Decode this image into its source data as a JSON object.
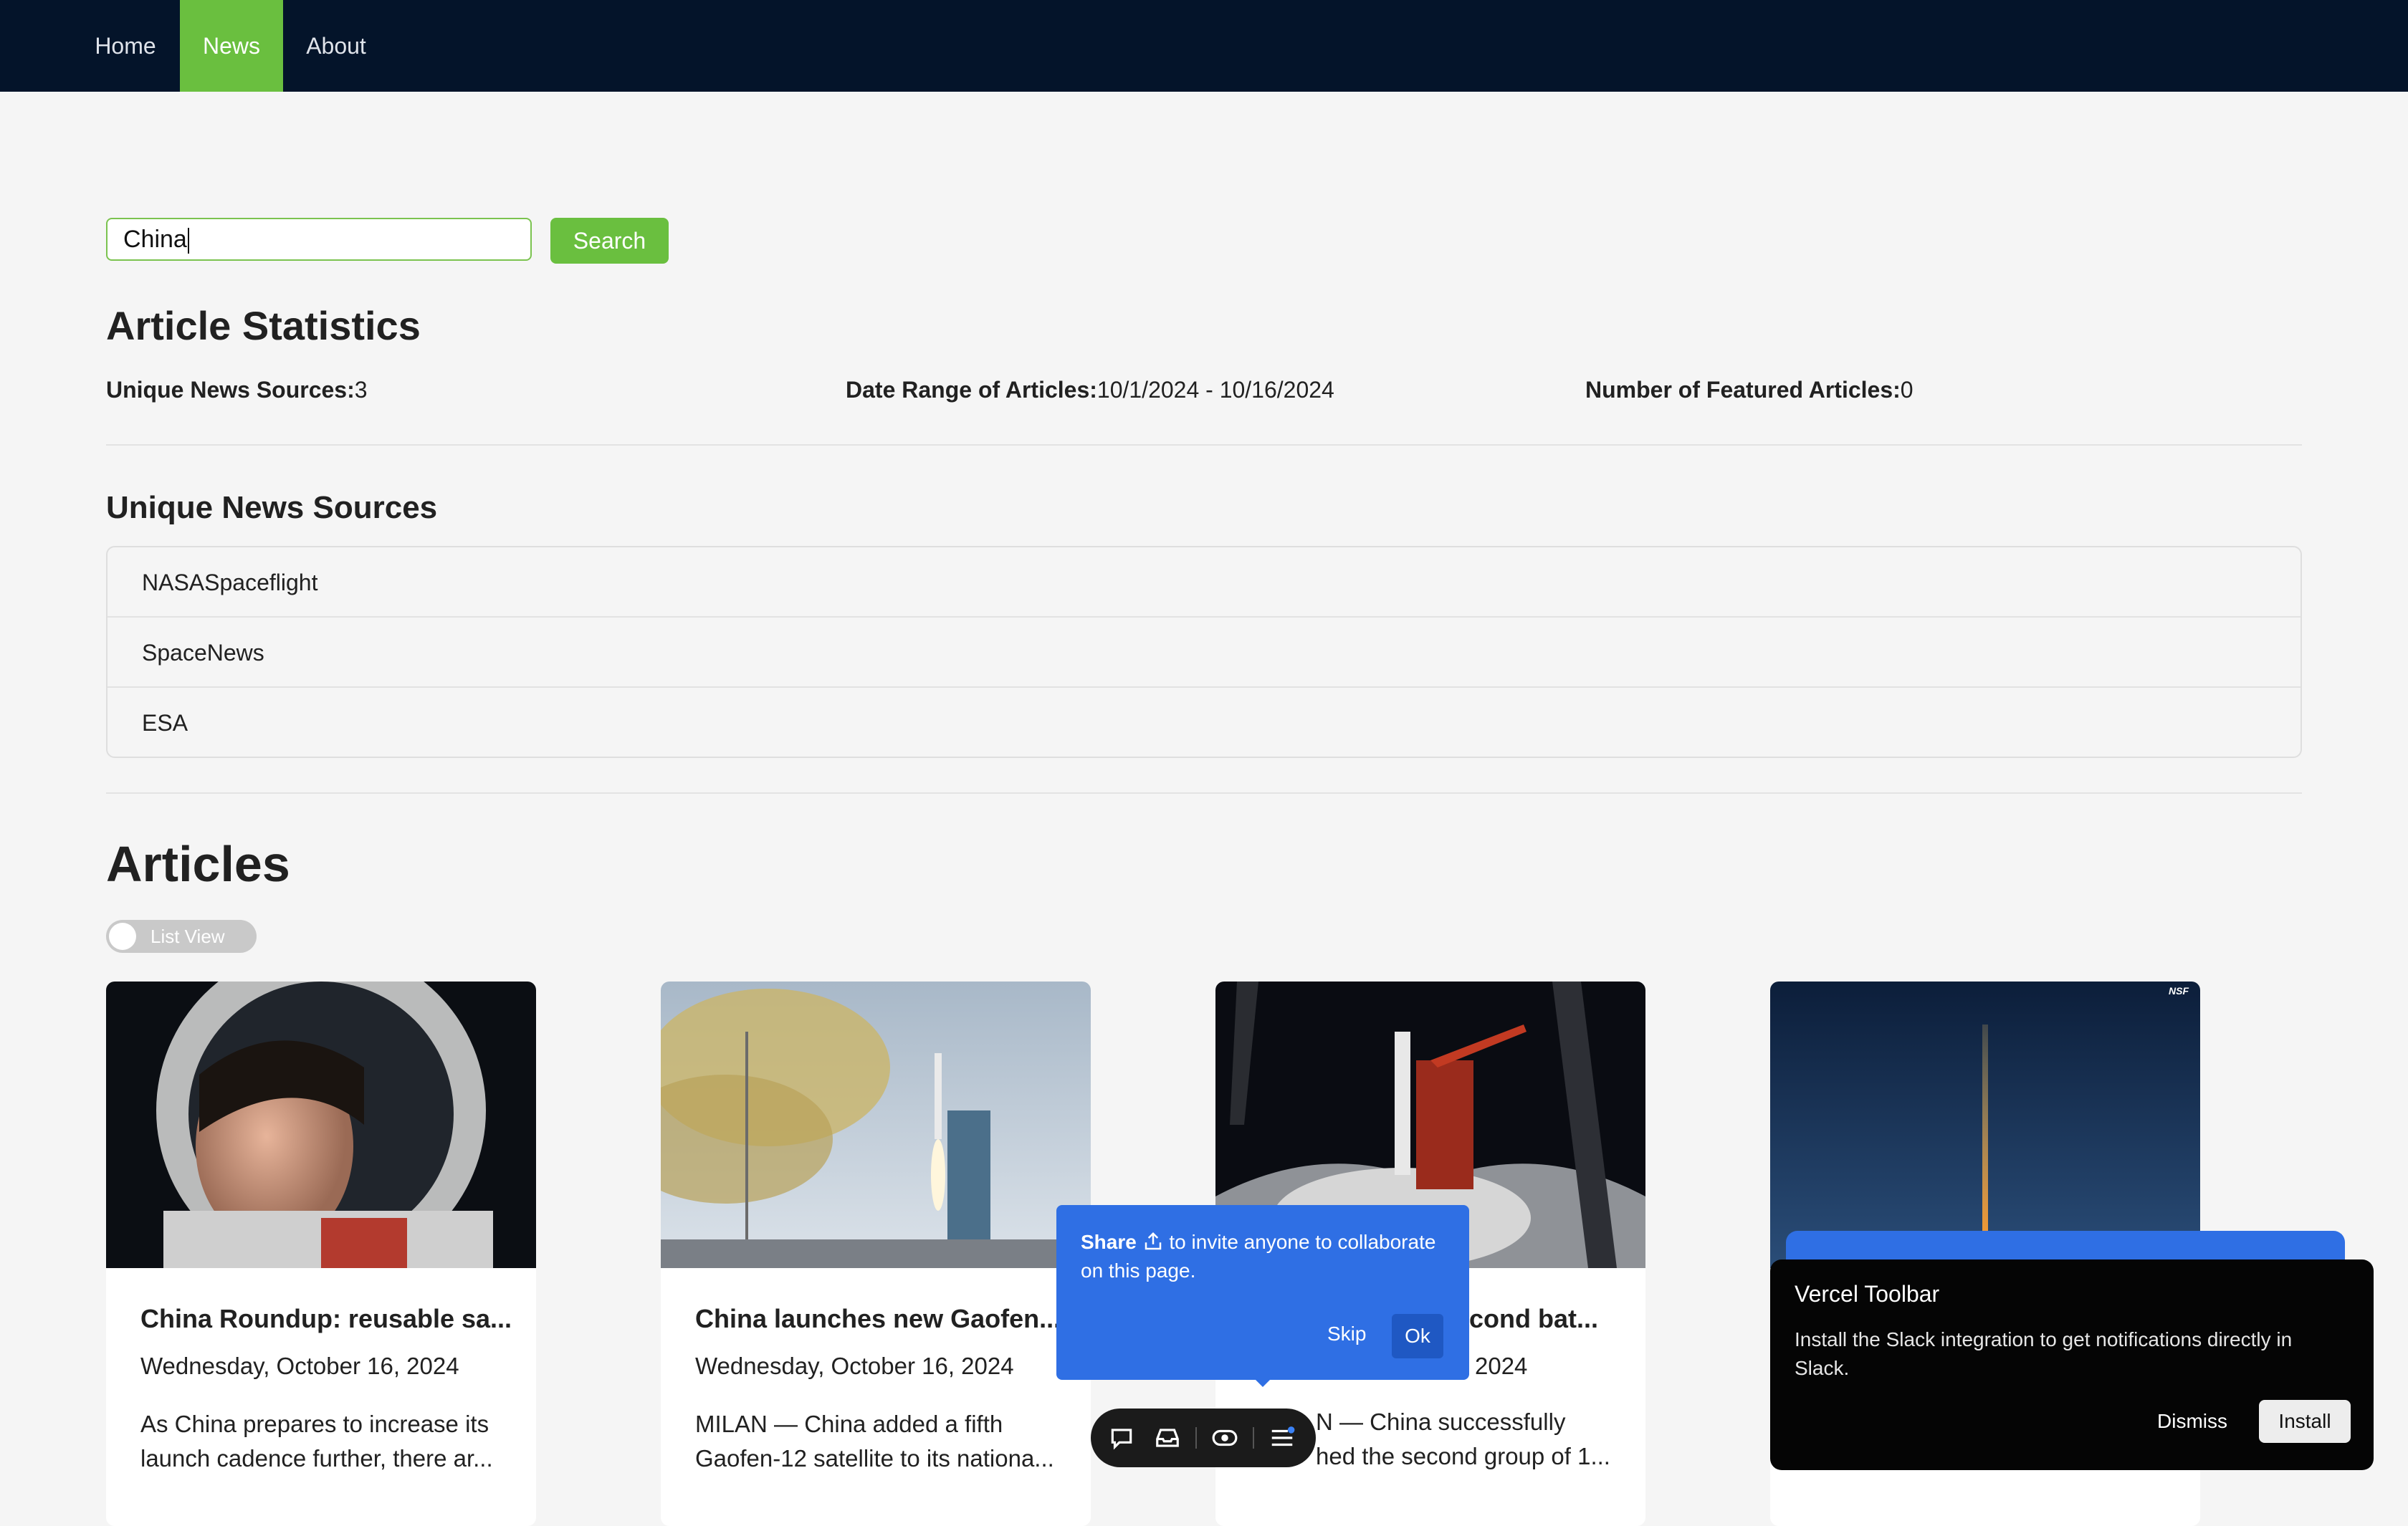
{
  "nav": {
    "items": [
      {
        "label": "Home"
      },
      {
        "label": "News"
      },
      {
        "label": "About"
      }
    ],
    "active": "News"
  },
  "search": {
    "value": "China",
    "button_label": "Search"
  },
  "stats": {
    "heading": "Article Statistics",
    "unique_sources_label": "Unique News Sources:",
    "unique_sources_value": "3",
    "date_range_label": "Date Range of Articles:",
    "date_range_value": "10/1/2024 - 10/16/2024",
    "featured_label": "Number of Featured Articles:",
    "featured_value": "0"
  },
  "sources": {
    "heading": "Unique News Sources",
    "items": [
      "NASASpaceflight",
      "SpaceNews",
      "ESA"
    ]
  },
  "articles": {
    "heading": "Articles",
    "toggle_label": "List View",
    "cards": [
      {
        "title": "China Roundup: reusable sa...",
        "date": "Wednesday, October 16, 2024",
        "desc": "As China prepares to increase its launch cadence further, there ar..."
      },
      {
        "title": "China launches new Gaofen...",
        "date": "Wednesday, October 16, 2024",
        "desc": "MILAN — China added a fifth Gaofen-12 satellite to its nationa..."
      },
      {
        "title_visible": "cond bat...",
        "date_visible": "2024",
        "desc_line1": "N — China successfully",
        "desc_line2": "hed the second group of 1..."
      },
      {
        "image_badge": "NSF"
      }
    ]
  },
  "share_popup": {
    "bold": "Share",
    "text": "to invite anyone to collaborate on this page.",
    "skip": "Skip",
    "ok": "Ok"
  },
  "vercel": {
    "title": "Vercel Toolbar",
    "body": "Install the Slack integration to get notifications directly in Slack.",
    "dismiss": "Dismiss",
    "install": "Install"
  },
  "colors": {
    "nav_bg": "#04142a",
    "accent_green": "#6abf3f",
    "popup_blue": "#2f6fe4"
  }
}
